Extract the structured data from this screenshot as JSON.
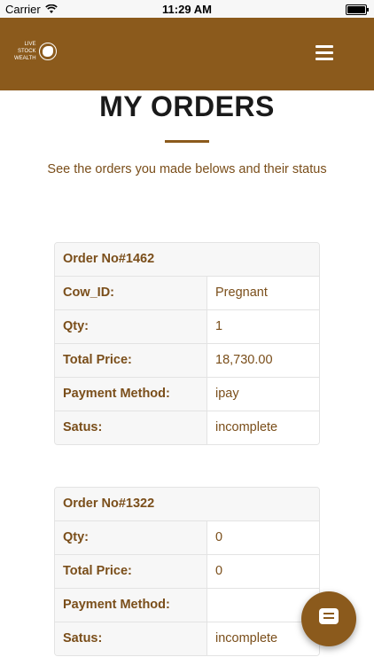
{
  "status_bar": {
    "carrier": "Carrier",
    "time": "11:29 AM"
  },
  "header": {
    "logo_lines": [
      "LIVE",
      "STOCK",
      "WEALTH"
    ],
    "logo_tagline": "",
    "menu_icon": "hamburger-menu-icon"
  },
  "main": {
    "title": "MY ORDERS",
    "subtitle": "See the orders you made belows and their status",
    "orders": [
      {
        "header": "Order No#1462",
        "rows": [
          {
            "label": "Cow_ID:",
            "value": "Pregnant"
          },
          {
            "label": "Qty:",
            "value": "1"
          },
          {
            "label": "Total Price:",
            "value": "18,730.00"
          },
          {
            "label": "Payment Method:",
            "value": "ipay"
          },
          {
            "label": "Satus:",
            "value": "incomplete"
          }
        ]
      },
      {
        "header": "Order No#1322",
        "rows": [
          {
            "label": "Qty:",
            "value": "0"
          },
          {
            "label": "Total Price:",
            "value": "0"
          },
          {
            "label": "Payment Method:",
            "value": ""
          },
          {
            "label": "Satus:",
            "value": "incomplete"
          }
        ]
      }
    ]
  },
  "chat_button": {
    "icon": "chat-bubble-icon"
  },
  "colors": {
    "brand": "#8b5a1c",
    "label_text": "#7a4e1a",
    "border": "#e3e3e3",
    "label_bg": "#f7f7f7"
  }
}
